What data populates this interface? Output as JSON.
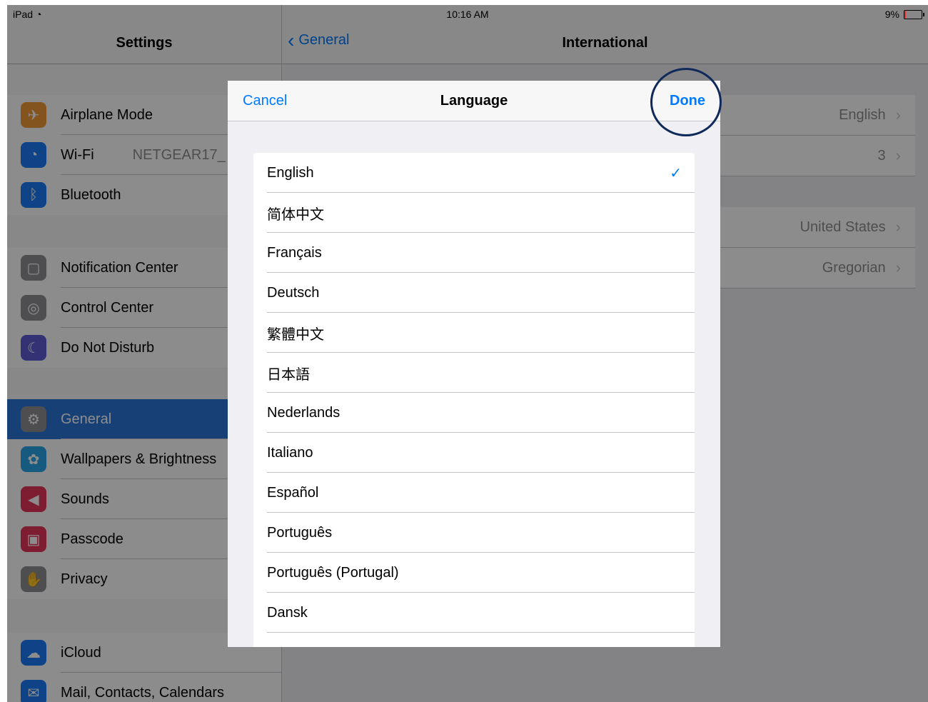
{
  "status": {
    "device": "iPad",
    "time": "10:16 AM",
    "battery": "9%",
    "battery_level": 0.09
  },
  "sidebar": {
    "title": "Settings",
    "groups": [
      {
        "items": [
          {
            "label": "Airplane Mode",
            "icon": "airplane-icon",
            "color": "#f19a38"
          },
          {
            "label": "Wi-Fi",
            "value": "NETGEAR17_",
            "icon": "wifi-icon",
            "color": "#1b7cf6"
          },
          {
            "label": "Bluetooth",
            "icon": "bluetooth-icon",
            "color": "#1b7cf6"
          }
        ]
      },
      {
        "items": [
          {
            "label": "Notification Center",
            "icon": "notification-icon",
            "color": "#8e8e93"
          },
          {
            "label": "Control Center",
            "icon": "toggles-icon",
            "color": "#8e8e93"
          },
          {
            "label": "Do Not Disturb",
            "icon": "moon-icon",
            "color": "#5b5bd6"
          }
        ]
      },
      {
        "items": [
          {
            "label": "General",
            "icon": "gear-icon",
            "color": "#8e8e93",
            "selected": true
          },
          {
            "label": "Wallpapers & Brightness",
            "icon": "flower-icon",
            "color": "#2aa5e8"
          },
          {
            "label": "Sounds",
            "icon": "speaker-icon",
            "color": "#e5335a"
          },
          {
            "label": "Passcode",
            "icon": "lock-icon",
            "color": "#e5335a"
          },
          {
            "label": "Privacy",
            "icon": "hand-icon",
            "color": "#8e8e93"
          }
        ]
      },
      {
        "items": [
          {
            "label": "iCloud",
            "icon": "cloud-icon",
            "color": "#1b7cf6"
          },
          {
            "label": "Mail, Contacts, Calendars",
            "icon": "mail-icon",
            "color": "#1b7cf6"
          }
        ]
      }
    ]
  },
  "detail": {
    "back_label": "General",
    "title": "International",
    "rows": [
      {
        "value": "English"
      },
      {
        "value": "3"
      },
      {
        "value": "United States"
      },
      {
        "value": "Gregorian"
      }
    ]
  },
  "modal": {
    "cancel": "Cancel",
    "title": "Language",
    "done": "Done",
    "languages": [
      {
        "label": "English",
        "checked": true
      },
      {
        "label": "简体中文"
      },
      {
        "label": "Français"
      },
      {
        "label": "Deutsch"
      },
      {
        "label": "繁體中文"
      },
      {
        "label": "日本語"
      },
      {
        "label": "Nederlands"
      },
      {
        "label": "Italiano"
      },
      {
        "label": "Español"
      },
      {
        "label": "Português"
      },
      {
        "label": "Português (Portugal)"
      },
      {
        "label": "Dansk"
      },
      {
        "label": ""
      }
    ]
  }
}
